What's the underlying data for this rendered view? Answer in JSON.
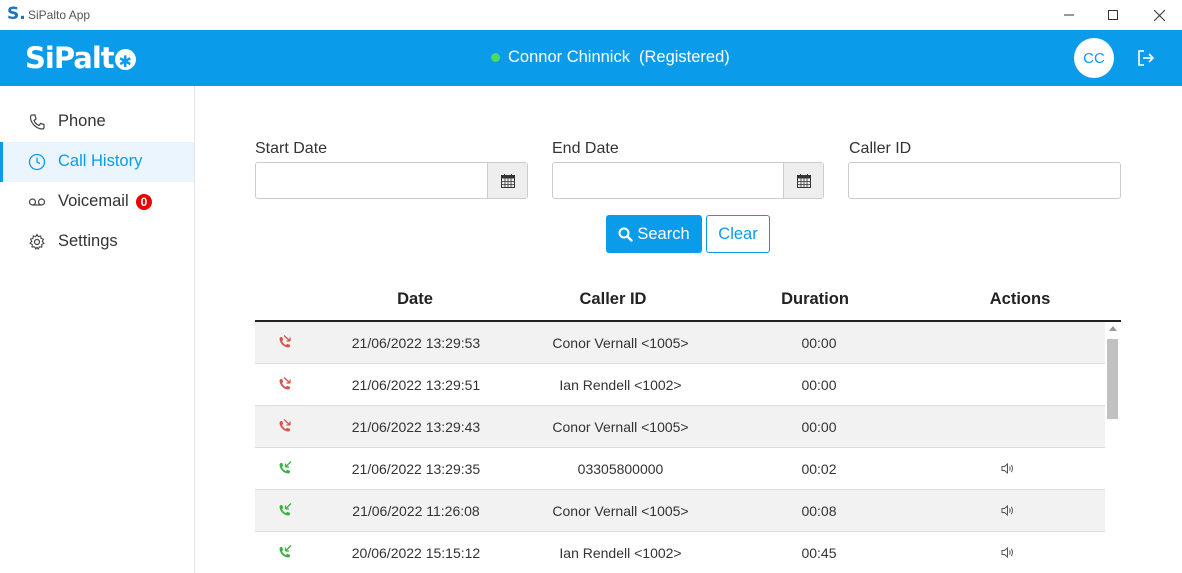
{
  "window": {
    "icon_letter": "S.",
    "title": "SiPalto App"
  },
  "header": {
    "logo_text": "SiPalt",
    "user_name": "Connor Chinnick",
    "registration_status": "(Registered)",
    "status_color": "#4cd964",
    "avatar_initials": "CC",
    "brand_color": "#0a9bea"
  },
  "sidebar": {
    "items": [
      {
        "label": "Phone",
        "icon": "phone-icon"
      },
      {
        "label": "Call History",
        "icon": "clock-icon",
        "active": true
      },
      {
        "label": "Voicemail",
        "icon": "voicemail-icon",
        "badge": "0"
      },
      {
        "label": "Settings",
        "icon": "gear-icon"
      }
    ]
  },
  "filters": {
    "start_date_label": "Start Date",
    "start_date_value": "",
    "end_date_label": "End Date",
    "end_date_value": "",
    "caller_id_label": "Caller ID",
    "caller_id_value": "",
    "search_label": "Search",
    "clear_label": "Clear"
  },
  "table": {
    "columns": [
      "Date",
      "Caller ID",
      "Duration",
      "Actions"
    ],
    "rows": [
      {
        "direction": "missed",
        "date": "21/06/2022 13:29:53",
        "caller_id": "Conor Vernall <1005>",
        "duration": "00:00",
        "has_recording": false
      },
      {
        "direction": "missed",
        "date": "21/06/2022 13:29:51",
        "caller_id": "Ian Rendell <1002>",
        "duration": "00:00",
        "has_recording": false
      },
      {
        "direction": "missed",
        "date": "21/06/2022 13:29:43",
        "caller_id": "Conor Vernall <1005>",
        "duration": "00:00",
        "has_recording": false
      },
      {
        "direction": "answered",
        "date": "21/06/2022 13:29:35",
        "caller_id": "03305800000",
        "duration": "00:02",
        "has_recording": true
      },
      {
        "direction": "answered",
        "date": "21/06/2022 11:26:08",
        "caller_id": "Conor Vernall <1005>",
        "duration": "00:08",
        "has_recording": true
      },
      {
        "direction": "answered",
        "date": "20/06/2022 15:15:12",
        "caller_id": "Ian Rendell <1002>",
        "duration": "00:45",
        "has_recording": true
      }
    ],
    "missed_color": "#d9534f",
    "answered_color": "#3cb043"
  }
}
